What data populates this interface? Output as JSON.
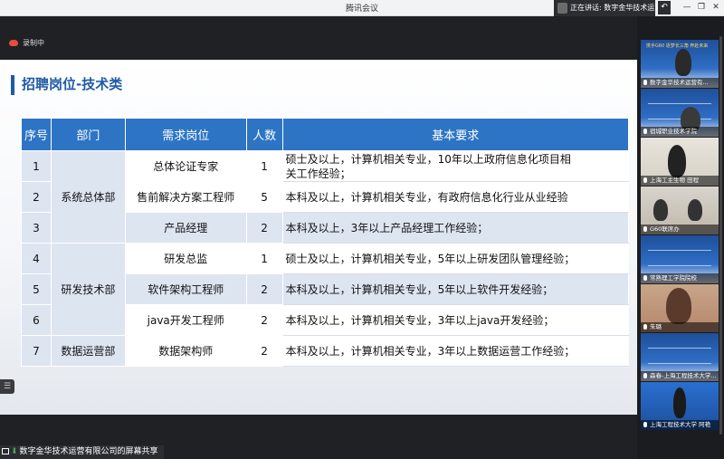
{
  "window": {
    "title": "腾讯会议",
    "speaking_label": "正在讲话: 数字金华技术运...",
    "back_icon": "undo-icon"
  },
  "stage": {
    "recording_label": "录制中",
    "share_label": "数字金华技术运营有限公司的屏幕共享"
  },
  "slide": {
    "title": "招聘岗位-技术类",
    "headers": [
      "序号",
      "部门",
      "需求岗位",
      "人数",
      "基本要求"
    ],
    "departments": [
      "系统总体部",
      "研发技术部",
      "数据运营部"
    ],
    "rows": [
      {
        "no": "1",
        "position": "总体论证专家",
        "count": "1",
        "req_line1": "硕士及以上，计算机相关专业，10年以上政府信息化项目相",
        "req_line2": "关工作经验；"
      },
      {
        "no": "2",
        "position": "售前解决方案工程师",
        "count": "5",
        "req_line1": "本科及以上，计算机相关专业，有政府信息化行业从业经验",
        "req_line2": ""
      },
      {
        "no": "3",
        "position": "产品经理",
        "count": "2",
        "req_line1": "本科及以上，3年以上产品经理工作经验；",
        "req_line2": ""
      },
      {
        "no": "4",
        "position": "研发总监",
        "count": "1",
        "req_line1": "硕士及以上，计算机相关专业，5年以上研发团队管理经验；",
        "req_line2": ""
      },
      {
        "no": "5",
        "position": "软件架构工程师",
        "count": "2",
        "req_line1": "本科及以上，计算机相关专业，5年以上软件开发经验；",
        "req_line2": ""
      },
      {
        "no": "6",
        "position": "java开发工程师",
        "count": "2",
        "req_line1": "本科及以上，计算机相关专业，3年以上java开发经验；",
        "req_line2": ""
      },
      {
        "no": "7",
        "position": "数据架构师",
        "count": "2",
        "req_line1": "本科及以上，计算机相关专业，3年以上数据运营工作经验；",
        "req_line2": ""
      }
    ]
  },
  "participants": [
    {
      "name": "数字金华技术运营有..."
    },
    {
      "name": "宿城职业技术学院"
    },
    {
      "name": "上海工主生物 田程"
    },
    {
      "name": "G60联席办"
    },
    {
      "name": "常熟理工学院院校"
    },
    {
      "name": "朱璐"
    },
    {
      "name": "森春-上海工程技术大学..."
    },
    {
      "name": "上海工程技术大学 阿艳"
    }
  ],
  "poster_text": "携手G60 逐梦长三角 奔赴未来"
}
